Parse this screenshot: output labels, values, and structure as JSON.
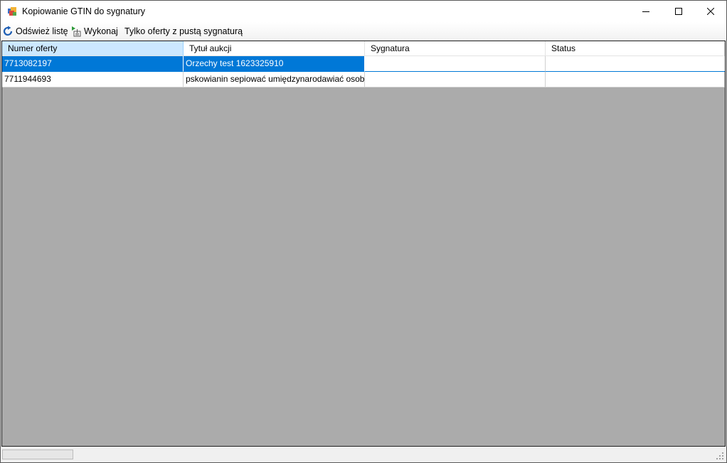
{
  "window": {
    "title": "Kopiowanie GTIN do sygnatury"
  },
  "toolbar": {
    "refresh_label": "Odśwież listę",
    "execute_label": "Wykonaj",
    "filter_label": "Tylko oferty z pustą sygnaturą"
  },
  "grid": {
    "columns": [
      "Numer oferty",
      "Tytuł aukcji",
      "Sygnatura",
      "Status"
    ],
    "rows": [
      {
        "offer": "7713082197",
        "title": "Orzechy test 1623325910",
        "signature": "",
        "status": ""
      },
      {
        "offer": "7711944693",
        "title": "pskowianin sepiować umiędzynarodawiać osobniak",
        "signature": "",
        "status": ""
      }
    ],
    "selected_row": 0
  },
  "statusbar": {
    "progress_fraction": 0
  },
  "colors": {
    "selection": "#0078d7",
    "grid_background": "#ababab",
    "header_selected": "#cce8ff"
  },
  "icons": {
    "app": "app-icon",
    "refresh": "refresh-icon",
    "execute": "execute-icon",
    "minimize": "minimize-icon",
    "maximize": "maximize-icon",
    "close": "close-icon"
  }
}
